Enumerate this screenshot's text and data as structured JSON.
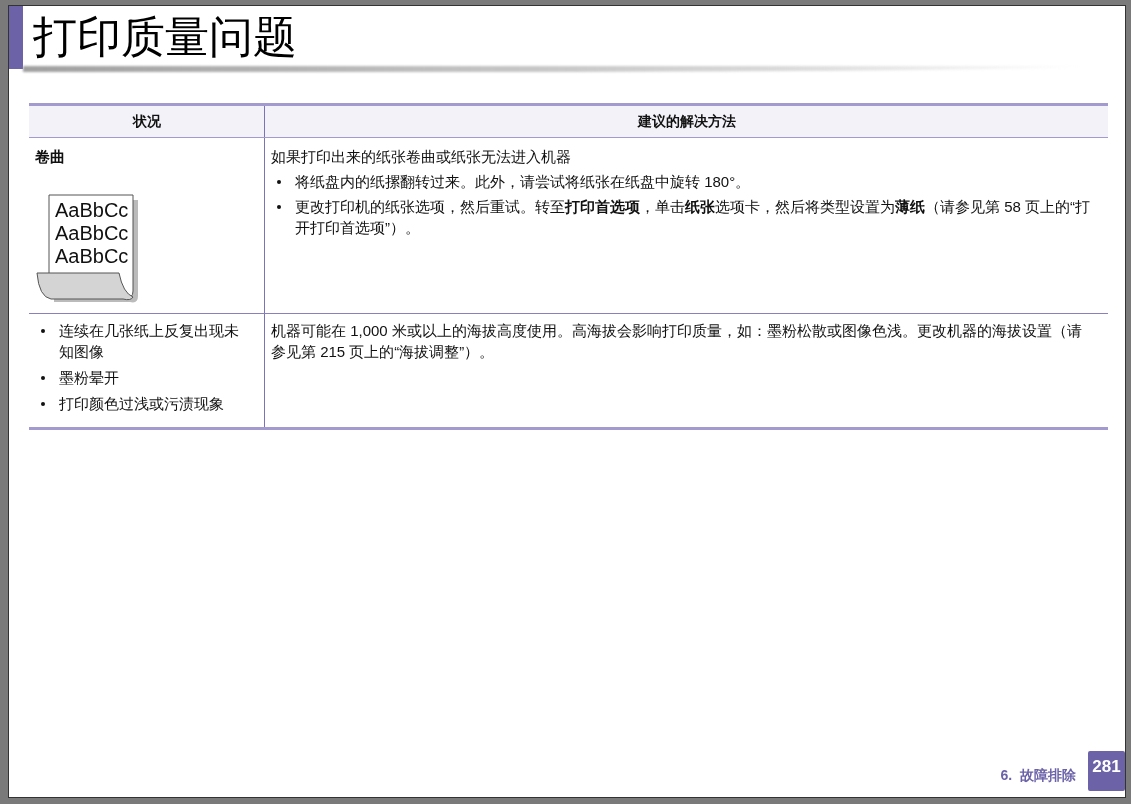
{
  "title": "打印质量问题",
  "table": {
    "columns": [
      "状况",
      "建议的解决方法"
    ],
    "rows": [
      {
        "kind": "illustrated",
        "condition": "卷曲",
        "illustration_lines": [
          "AaBbCc",
          "AaBbCc",
          "AaBbCc"
        ],
        "solution_intro": "如果打印出来的纸张卷曲或纸张无法进入机器",
        "solution_bullets": [
          "将纸盘内的纸摞翻转过来。此外，请尝试将纸张在纸盘中旋转 180°。",
          "更改打印机的纸张选项，然后重试。转至**打印首选项**，单击**纸张**选项卡，然后将类型设置为**薄纸**（请参见第 58 页上的“打开打印首选项”）。"
        ]
      },
      {
        "kind": "list",
        "condition_bullets": [
          "连续在几张纸上反复出现未知图像",
          "墨粉晕开",
          "打印颜色过浅或污渍现象"
        ],
        "solution_text": "机器可能在 1,000 米或以上的海拔高度使用。高海拔会影响打印质量，如：墨粉松散或图像色浅。更改机器的海拔设置（请参见第 215 页上的“海拔调整”）。"
      }
    ]
  },
  "footer": {
    "chapter": "6.  故障排除",
    "page_number": "281"
  }
}
